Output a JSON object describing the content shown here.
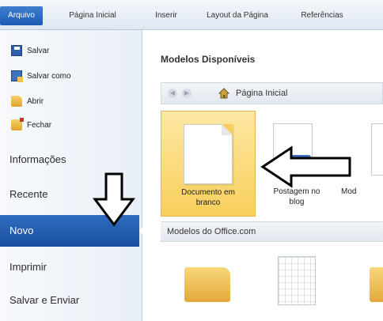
{
  "ribbon": {
    "tabs": [
      "Arquivo",
      "Página Inicial",
      "Inserir",
      "Layout da Página",
      "Referências"
    ]
  },
  "sidebar": {
    "quick": [
      "Salvar",
      "Salvar como",
      "Abrir",
      "Fechar"
    ],
    "items": [
      "Informações",
      "Recente",
      "Novo",
      "Imprimir",
      "Salvar e Enviar"
    ],
    "selected": "Novo"
  },
  "main": {
    "section_title": "Modelos Disponíveis",
    "nav_label": "Página Inicial",
    "templates": [
      {
        "label": "Documento em\nbranco"
      },
      {
        "label": "Postagem no\nblog"
      },
      {
        "label": "Mod"
      }
    ],
    "office_label": "Modelos do Office.com"
  },
  "colors": {
    "accent": "#1d5bb3",
    "selection": "#f8cf5c"
  }
}
